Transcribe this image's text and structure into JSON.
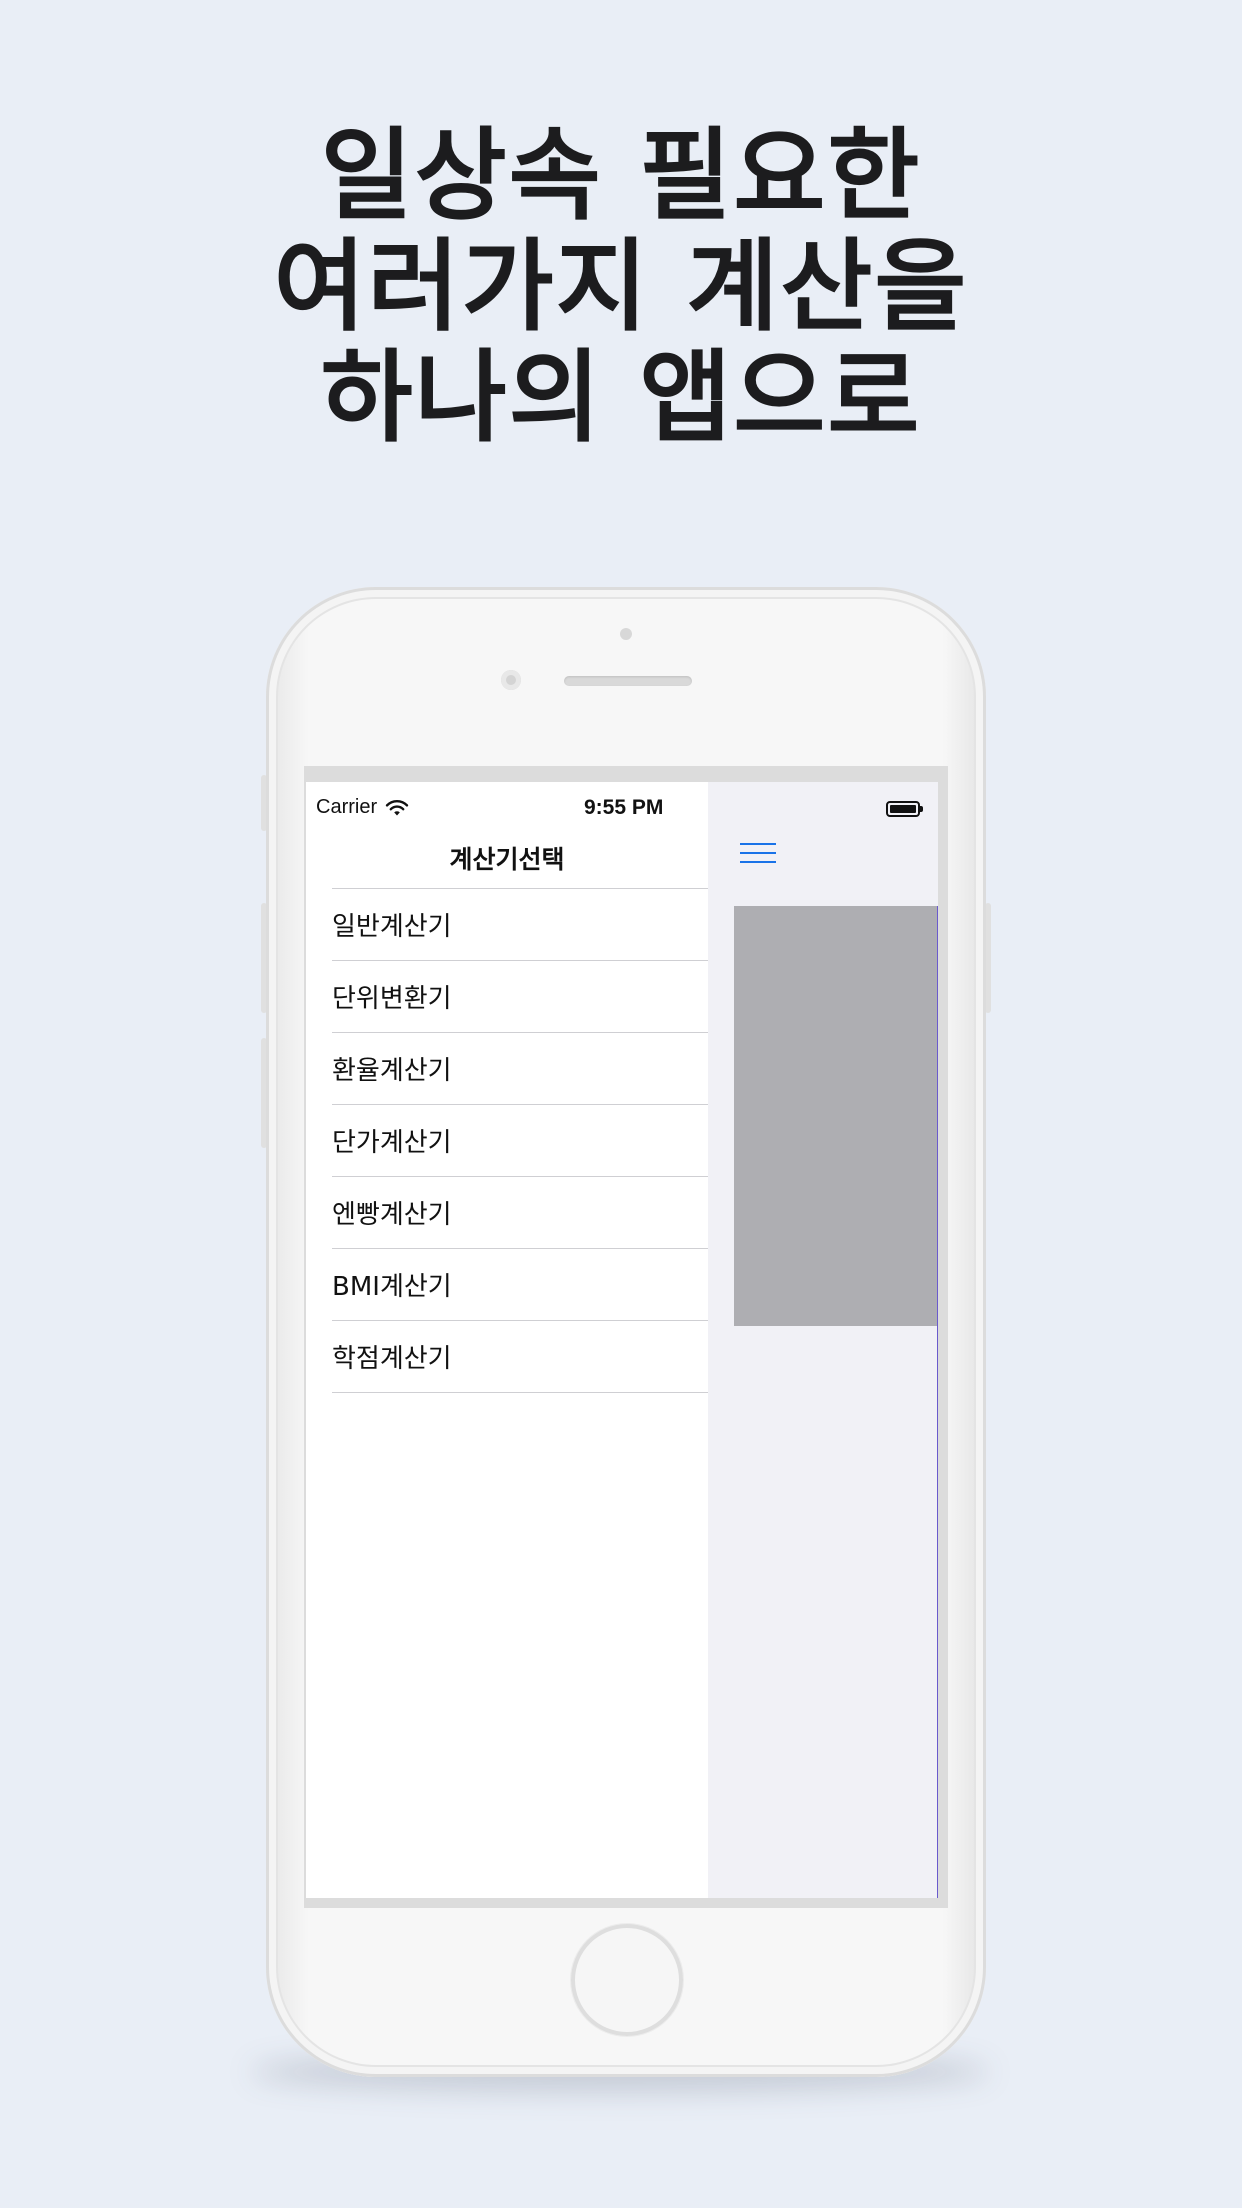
{
  "headline": {
    "line1": "일상속 필요한",
    "line2": "여러가지 계산을",
    "line3": "하나의 앱으로"
  },
  "status_bar": {
    "carrier": "Carrier",
    "time": "9:55 PM"
  },
  "menu": {
    "title": "계산기선택",
    "items": [
      {
        "label": "일반계산기"
      },
      {
        "label": "단위변환기"
      },
      {
        "label": "환율계산기"
      },
      {
        "label": "단가계산기"
      },
      {
        "label": "엔빵계산기"
      },
      {
        "label": "BMI계산기"
      },
      {
        "label": "학점계산기"
      }
    ]
  },
  "colors": {
    "background": "#e9eef6",
    "accent": "#1a73e8",
    "placeholder_gray": "#aeaeb2"
  },
  "icons": {
    "wifi": "wifi-icon",
    "battery": "battery-icon",
    "menu": "hamburger-menu-icon"
  }
}
